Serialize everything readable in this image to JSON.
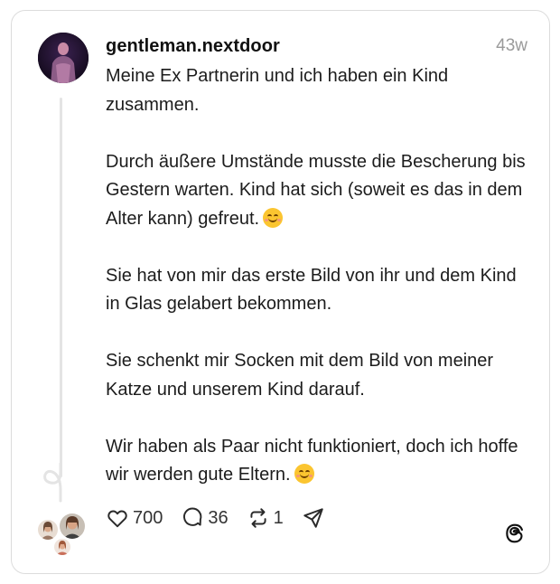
{
  "post": {
    "username": "gentleman.nextdoor",
    "timestamp": "43w",
    "paragraphs": [
      {
        "text": "Meine Ex Partnerin und ich haben ein Kind zusammen.",
        "emoji": false
      },
      {
        "text": "Durch äußere Umstände musste die Bescherung bis Gestern warten. Kind hat sich (soweit es das in dem Alter kann) gefreut.",
        "emoji": true
      },
      {
        "text": "Sie hat von mir das erste Bild von ihr und dem Kind in Glas gelabert bekommen.",
        "emoji": false
      },
      {
        "text": "Sie schenkt mir Socken mit dem Bild von meiner Katze und unserem Kind darauf.",
        "emoji": false
      },
      {
        "text": "Wir haben als Paar nicht funktioniert, doch ich hoffe wir werden gute Eltern.",
        "emoji": true
      }
    ]
  },
  "actions": {
    "likes": "700",
    "replies": "36",
    "reposts": "1"
  },
  "icons": {
    "like": "heart-icon",
    "reply": "speech-bubble-icon",
    "repost": "repost-icon",
    "share": "send-icon",
    "brand": "threads-logo-icon",
    "emoji": "smiling-face-emoji"
  },
  "colors": {
    "text": "#1c1c1c",
    "muted": "#9a9a9a",
    "border": "#dcdcdc",
    "emoji": "#fbc530"
  }
}
